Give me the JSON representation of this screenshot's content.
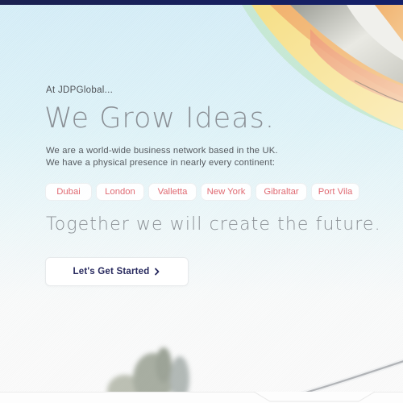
{
  "header": {
    "bar_color": "#1b2150"
  },
  "hero": {
    "eyebrow": "At JDPGlobal...",
    "headline": "We Grow Ideas.",
    "intro_lines": [
      "We are a world-wide business network based in the UK.",
      "We have a physical presence in nearly every continent:"
    ],
    "cities": [
      "Dubai",
      "London",
      "Valletta",
      "New York",
      "Gibraltar",
      "Port Vila"
    ],
    "tagline": "Together we will create the future.",
    "cta": {
      "label": "Let's Get Started",
      "icon": "chevron-right-icon"
    }
  },
  "colors": {
    "accent_red": "#e06a72",
    "navy": "#27295e",
    "headline_gray": "#8a8f95",
    "sky": "#d5eef8"
  },
  "imagery": {
    "background": "hot-air-balloon-sky-photo",
    "decorations": [
      "hot-air-balloon",
      "tree-silhouette",
      "balloon-rope"
    ]
  }
}
